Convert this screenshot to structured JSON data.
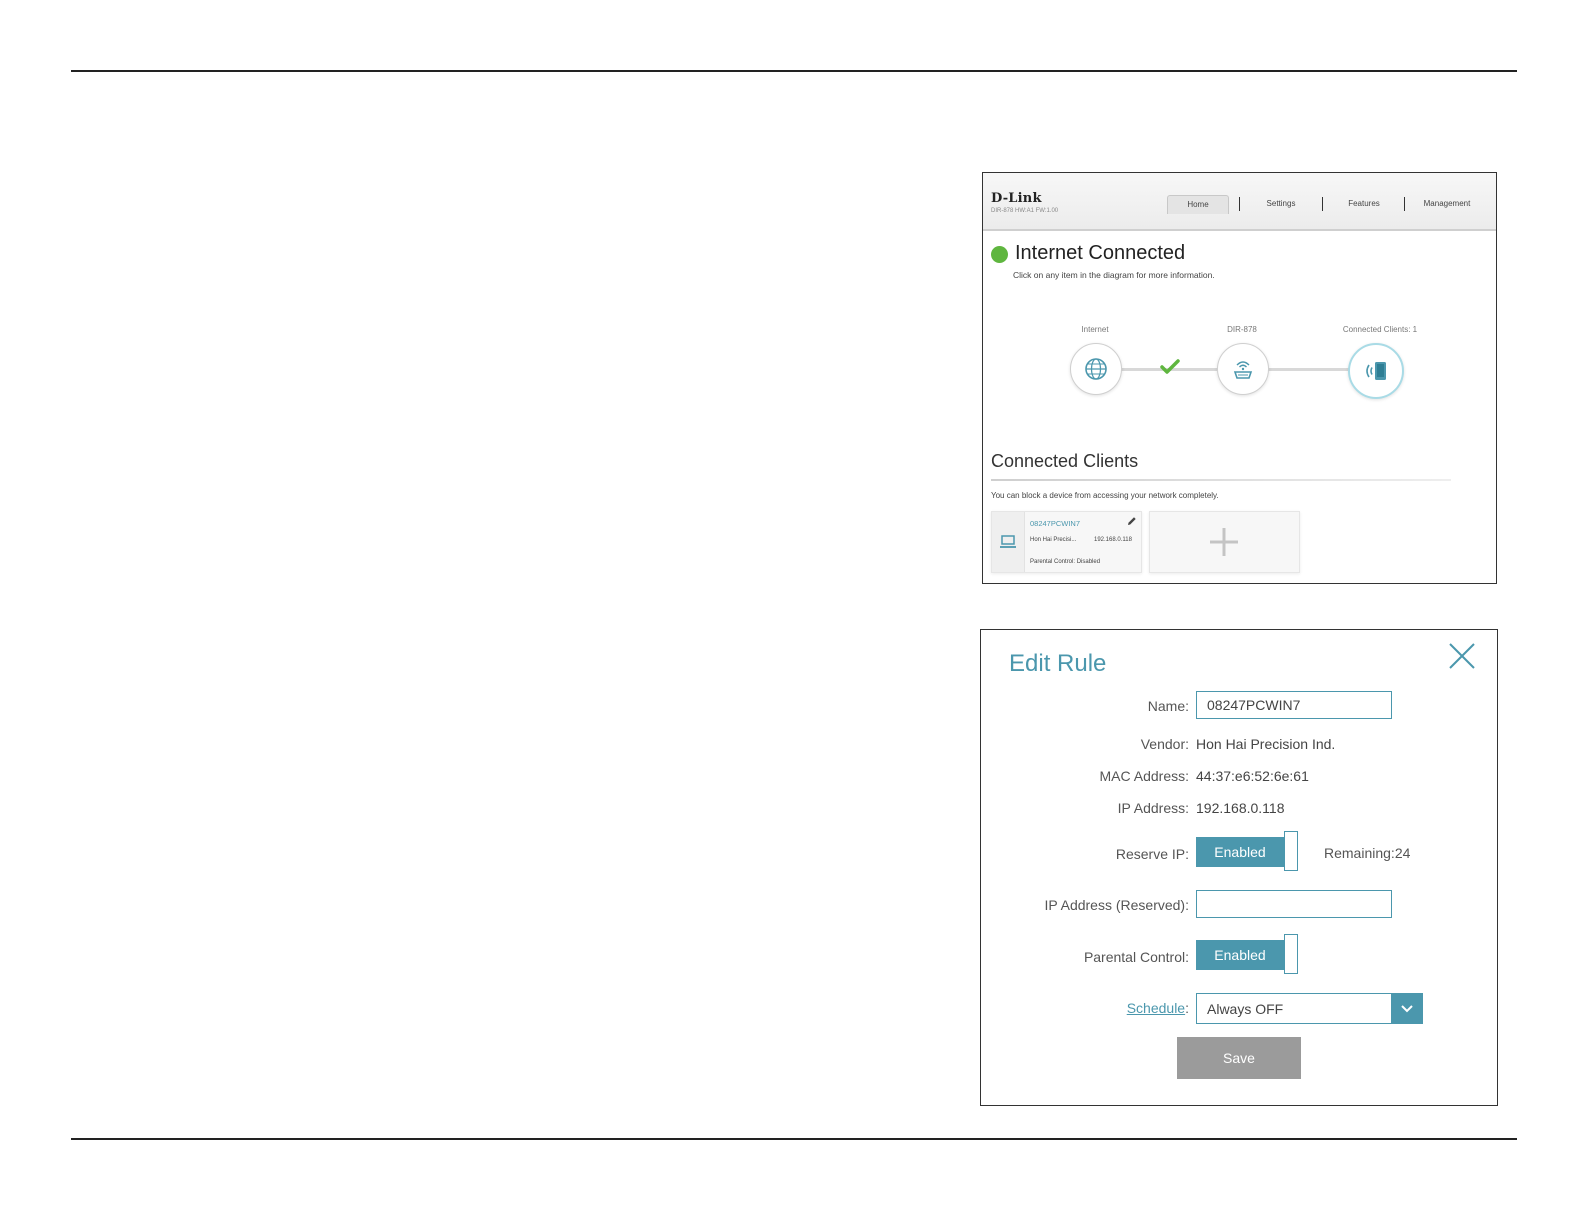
{
  "home": {
    "brand": "D-Link",
    "firmware": "DIR-878 HW:A1 FW:1.00",
    "tabs": [
      {
        "label": "Home",
        "active": true
      },
      {
        "label": "Settings"
      },
      {
        "label": "Features"
      },
      {
        "label": "Management"
      }
    ],
    "status_title": "Internet Connected",
    "status_subtitle": "Click on any item in the diagram for more information.",
    "status_color": "#5fb63f",
    "nodes": {
      "internet": "Internet",
      "router": "DIR-878",
      "clients": "Connected Clients: 1"
    },
    "connected_clients_title": "Connected Clients",
    "connected_clients_subtitle": "You can block a device from accessing your network completely.",
    "client": {
      "name": "08247PCWIN7",
      "vendor": "Hon Hai Precisi...",
      "ip": "192.168.0.118",
      "parental": "Parental Control: Disabled"
    },
    "icons": [
      "globe-icon",
      "router-icon",
      "wireless-device-icon",
      "check-icon",
      "laptop-icon",
      "pencil-icon",
      "plus-icon"
    ]
  },
  "edit_rule": {
    "title": "Edit Rule",
    "labels": {
      "name": "Name:",
      "vendor": "Vendor:",
      "mac": "MAC Address:",
      "ip": "IP Address:",
      "reserve_ip": "Reserve IP:",
      "ip_reserved": "IP Address (Reserved):",
      "parental": "Parental Control:",
      "schedule": "Schedule"
    },
    "schedule_colon": ":",
    "values": {
      "name": "08247PCWIN7",
      "vendor": "Hon Hai Precision Ind.",
      "mac": "44:37:e6:52:6e:61",
      "ip": "192.168.0.118",
      "ip_reserved": ""
    },
    "reserve_ip_state": "Enabled",
    "remaining": "Remaining:24",
    "parental_state": "Enabled",
    "schedule_value": "Always OFF",
    "save_label": "Save",
    "accent_color": "#4b97ad",
    "icons": [
      "close-icon",
      "chevron-down-icon"
    ]
  }
}
